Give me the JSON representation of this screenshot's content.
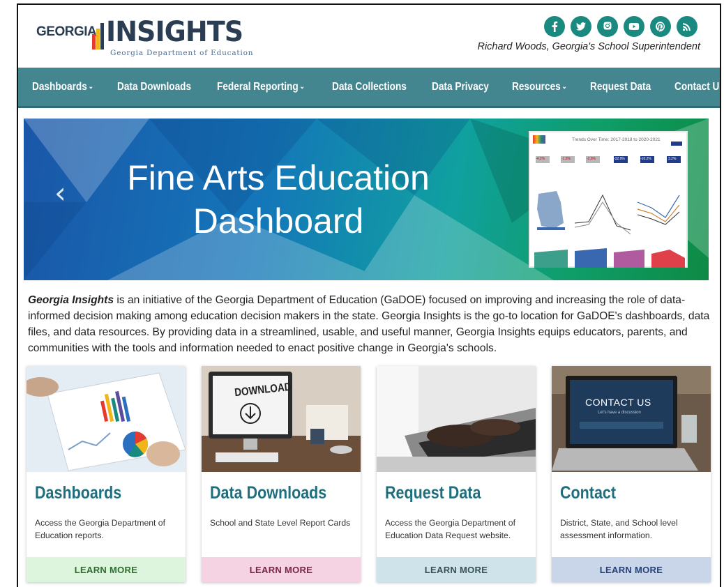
{
  "header": {
    "logo_georgia": "GEORGIA",
    "logo_insights": "INSIGHTS",
    "logo_sub": "Georgia Department of Education",
    "superintendent": "Richard Woods, Georgia's School Superintendent",
    "social_icons": [
      "facebook-icon",
      "twitter-icon",
      "instagram-icon",
      "youtube-icon",
      "pinterest-icon",
      "rss-icon"
    ],
    "social_color": "#1a8a80"
  },
  "nav": {
    "items": [
      {
        "label": "Dashboards",
        "caret": "⌄"
      },
      {
        "label": "Data Downloads",
        "caret": ""
      },
      {
        "label": "Federal Reporting",
        "caret": "⌄"
      },
      {
        "label": "Data Collections",
        "caret": ""
      },
      {
        "label": "Data Privacy",
        "caret": ""
      },
      {
        "label": "Resources",
        "caret": "⌄"
      },
      {
        "label": "Request Data",
        "caret": ""
      },
      {
        "label": "Contact Us",
        "caret": ""
      }
    ],
    "background": "#43868f"
  },
  "hero": {
    "prev_arrow": "‹",
    "title_line1": "Fine Arts Education",
    "title_line2": "Dashboard",
    "thumbnail": {
      "title": "Trends Over Time: 2017-2018 to 2020-2021",
      "kpis": [
        "-4.2%",
        "-1.8%",
        "-2.8%",
        "-32.9%",
        "-10.2%",
        "3.2%"
      ]
    }
  },
  "intro": {
    "lead": "Georgia Insights",
    "body": " is an initiative of the Georgia Department of Education (GaDOE) focused on improving and increasing the role of data-informed decision making among education decision makers in the state. Georgia Insights is the go-to location for GaDOE's dashboards, data files, and data resources. By providing data in a streamlined, usable, and useful manner, Georgia Insights equips educators, parents, and communities with the tools and information needed to enact positive change in Georgia's schools."
  },
  "cards": [
    {
      "title": "Dashboards",
      "desc": "Access the Georgia Department of Education reports.",
      "button": "LEARN MORE",
      "btn_bg": "#dcf5dc",
      "btn_color": "#2f6e2f"
    },
    {
      "title": "Data Downloads",
      "desc": "School and State Level Report Cards",
      "button": "LEARN MORE",
      "btn_bg": "#f6d3e3",
      "btn_color": "#7d2348",
      "image_text": "DOWNLOAD"
    },
    {
      "title": "Request Data",
      "desc": "Access the Georgia Department of Education Data Request website.",
      "button": "LEARN MORE",
      "btn_bg": "#cfe3ea",
      "btn_color": "#35505a"
    },
    {
      "title": "Contact",
      "desc": "District, State, and School level assessment information.",
      "button": "LEARN MORE",
      "btn_bg": "#c9d6ea",
      "btn_color": "#24407a",
      "image_text": "CONTACT US",
      "image_subtext": "Let's have a discussion"
    }
  ]
}
